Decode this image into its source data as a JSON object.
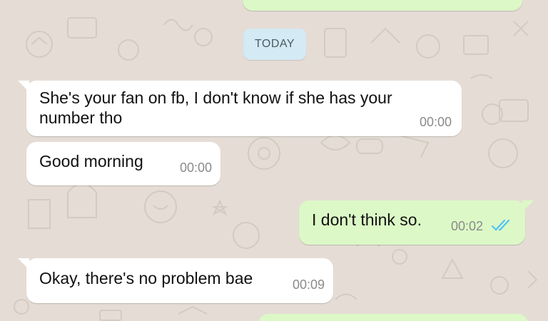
{
  "date_divider": "TODAY",
  "messages": [
    {
      "direction": "in",
      "lines": [
        "She's your fan on fb, I don't know if she has your",
        "number tho"
      ],
      "time": "00:00"
    },
    {
      "direction": "in",
      "lines": [
        "Good morning"
      ],
      "time": "00:00"
    },
    {
      "direction": "out",
      "lines": [
        "I don't think so."
      ],
      "time": "00:02",
      "status": "read"
    },
    {
      "direction": "in",
      "lines": [
        "Okay, there's no problem bae"
      ],
      "time": "00:09"
    }
  ],
  "colors": {
    "wallpaper": "#e5ddd5",
    "incoming_bubble": "#ffffff",
    "outgoing_bubble": "#dcf8c6",
    "read_ticks": "#4fc3f7"
  }
}
